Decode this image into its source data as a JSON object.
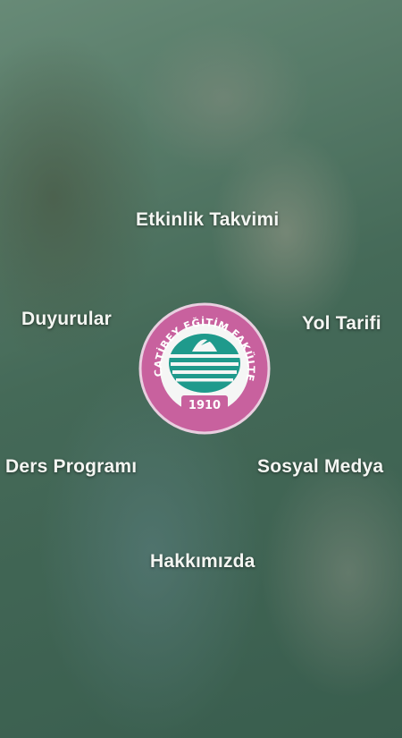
{
  "menu": {
    "events_calendar": "Etkinlik Takvimi",
    "announcements": "Duyurular",
    "directions": "Yol Tarifi",
    "course_schedule": "Ders Programı",
    "social_media": "Sosyal Medya",
    "about": "Hakkımızda"
  },
  "logo": {
    "ring_text": "NECATİBEY EĞİTİM FAKÜLTESİ",
    "year": "1910"
  },
  "colors": {
    "logo_ring": "#c8619e",
    "logo_teal": "#1f9a8c",
    "overlay": "#2f6a52"
  }
}
